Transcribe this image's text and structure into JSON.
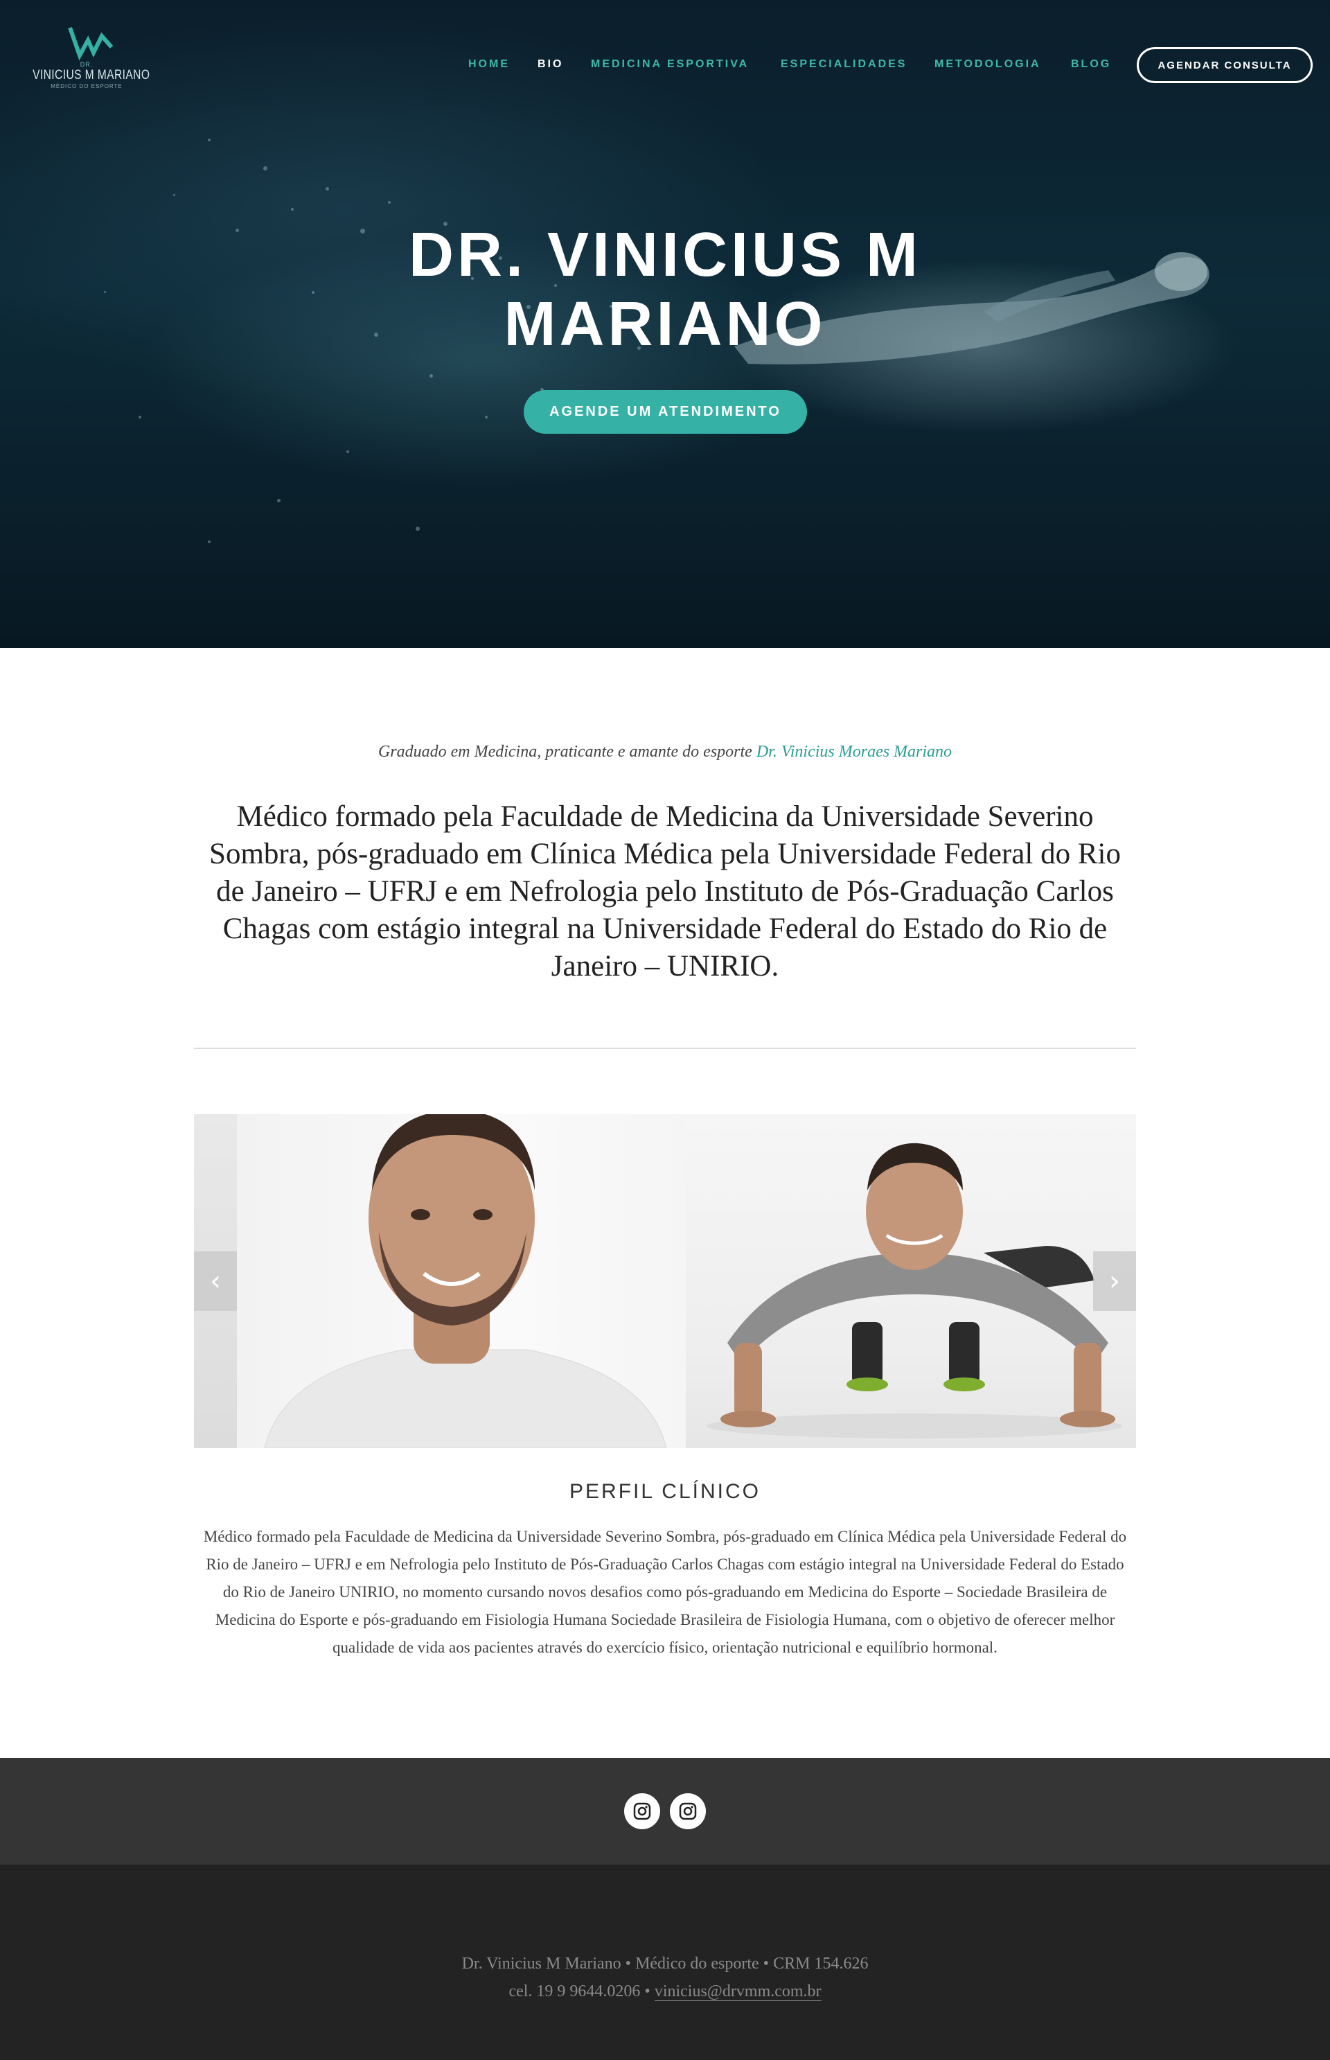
{
  "brand": {
    "logo_prefix": "DR.",
    "logo_name": "VINICIUS M MARIANO",
    "logo_subtitle": "MÉDICO DO ESPORTE"
  },
  "nav": {
    "items": [
      {
        "label": "HOME",
        "active": false
      },
      {
        "label": "BIO",
        "active": true
      },
      {
        "label": "MEDICINA ESPORTIVA",
        "active": false
      },
      {
        "label": "ESPECIALIDADES",
        "active": false
      },
      {
        "label": "METODOLOGIA",
        "active": false
      },
      {
        "label": "BLOG",
        "active": false
      }
    ],
    "cta_label": "AGENDAR CONSULTA"
  },
  "hero": {
    "title": "DR. VINICIUS M MARIANO",
    "button_label": "AGENDE UM ATENDIMENTO"
  },
  "intro": {
    "tagline_prefix": "Graduado em Medicina, praticante e amante do esporte",
    "tagline_name": "Dr. Vinicius Moraes Mariano",
    "text": "Médico formado pela Faculdade de Medicina da Universidade Severino Sombra, pós-graduado em Clínica Médica pela Universidade Federal do Rio de Janeiro – UFRJ e em Nefrologia pelo Instituto de Pós-Graduação Carlos Chagas com estágio integral na Universidade Federal do Estado do Rio de Janeiro – UNIRIO."
  },
  "gallery": {
    "prev_icon": "chevron-left-icon",
    "next_icon": "chevron-right-icon",
    "prev_glyph": "‹",
    "next_glyph": "›"
  },
  "profile": {
    "title": "PERFIL CLÍNICO",
    "text": "Médico formado pela Faculdade de Medicina da Universidade Severino Sombra, pós-graduado em Clínica Médica pela Universidade Federal do Rio de Janeiro – UFRJ e em Nefrologia pelo Instituto de Pós-Graduação Carlos Chagas com estágio integral na Universidade Federal do Estado do Rio de Janeiro  UNIRIO, no momento cursando novos desafios como pós-graduando em Medicina do Esporte – Sociedade Brasileira de Medicina do Esporte e pós-graduando em Fisiologia Humana Sociedade Brasileira de Fisiologia Humana, com o objetivo de oferecer melhor qualidade de vida aos pacientes através do exercício físico, orientação nutricional e equilíbrio hormonal."
  },
  "social": {
    "icons": [
      "instagram-icon",
      "instagram-icon"
    ]
  },
  "footer": {
    "line1": "Dr. Vinicius M Mariano • Médico do esporte • CRM 154.626",
    "phone": "cel. 19 9 9644.0206 •",
    "email": "vinicius@drvmm.com.br"
  },
  "colors": {
    "accent": "#36b1a6",
    "nav_link": "#3fb8aa",
    "hero_bg": "#0d2a38",
    "social_bar": "#353535",
    "footer_bg": "#232323"
  }
}
